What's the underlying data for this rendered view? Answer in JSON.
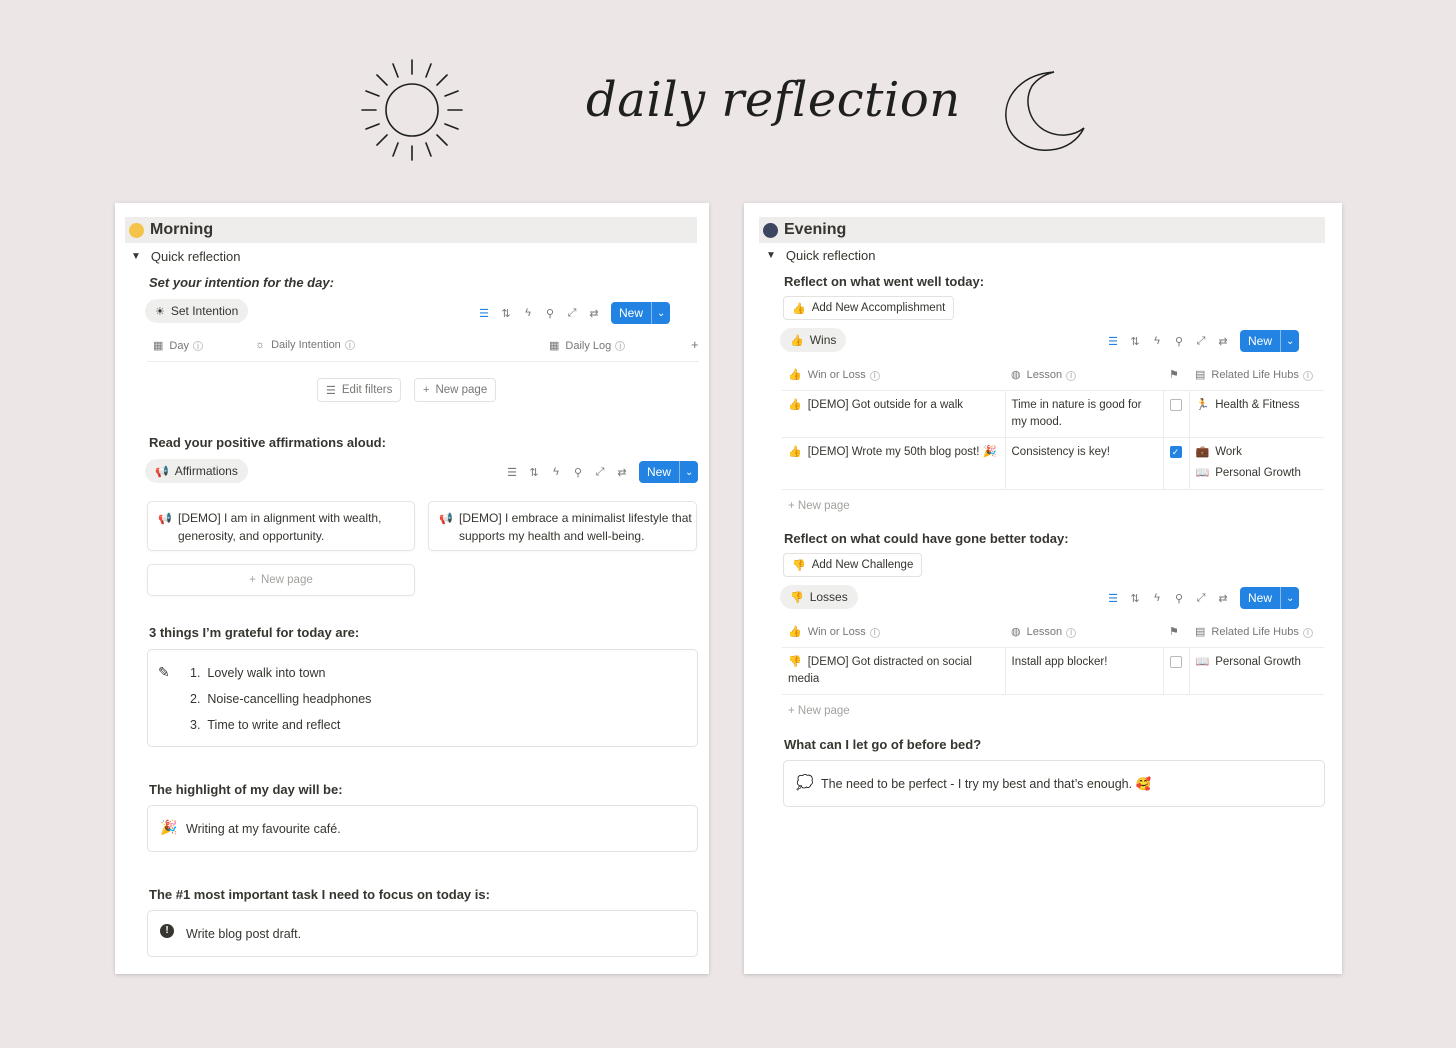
{
  "page_title": "daily reflection",
  "morning": {
    "heading": "Morning",
    "toggle": "Quick reflection",
    "intention_q": "Set your intention for the day:",
    "intention_view": "Set Intention",
    "new_label": "New",
    "cols": [
      "Day",
      "Daily Intention",
      "Daily Log"
    ],
    "edit_filters": "Edit filters",
    "new_page": "New page",
    "affirm_q": "Read your positive affirmations aloud:",
    "affirm_view": "Affirmations",
    "affirmations": [
      "[DEMO] I am in alignment with wealth, generosity, and opportunity.",
      "[DEMO] I embrace a minimalist lifestyle that supports my health and well-being."
    ],
    "grateful_q": "3 things I’m grateful for today are:",
    "grateful": [
      "Lovely walk into town",
      "Noise-cancelling headphones",
      "Time to write and reflect"
    ],
    "grateful_nums": [
      "1.",
      "2.",
      "3."
    ],
    "highlight_q": "The highlight of my day will be:",
    "highlight": "Writing at my favourite café.",
    "task_q": "The #1 most important task I need to focus on today is:",
    "task": "Write blog post draft."
  },
  "evening": {
    "heading": "Evening",
    "toggle": "Quick reflection",
    "well_q": "Reflect on what went well today:",
    "add_accomplishment": "Add New Accomplishment",
    "wins_view": "Wins",
    "new_label": "New",
    "cols": [
      "Win or Loss",
      "Lesson",
      "Related Life Hubs"
    ],
    "wins": [
      {
        "name": "[DEMO] Got outside for a walk",
        "lesson": "Time in nature is good for my mood.",
        "checked": false,
        "hubs": [
          "Health & Fitness"
        ]
      },
      {
        "name": "[DEMO] Wrote my 50th blog post! 🎉",
        "lesson": "Consistency is key!",
        "checked": true,
        "hubs": [
          "Work",
          "Personal Growth"
        ]
      }
    ],
    "new_page": "New page",
    "better_q": "Reflect on what could have gone better today:",
    "add_challenge": "Add New Challenge",
    "losses_view": "Losses",
    "losses": [
      {
        "name": "[DEMO] Got distracted on social media",
        "lesson": "Install app blocker!",
        "checked": false,
        "hubs": [
          "Personal Growth"
        ]
      }
    ],
    "letgo_q": "What can I let go of before bed?",
    "letgo": "The need to be perfect - I try my best and that’s enough. 🥰"
  },
  "colors": {
    "accent": "#2383e2",
    "background": "#ece6e6"
  }
}
